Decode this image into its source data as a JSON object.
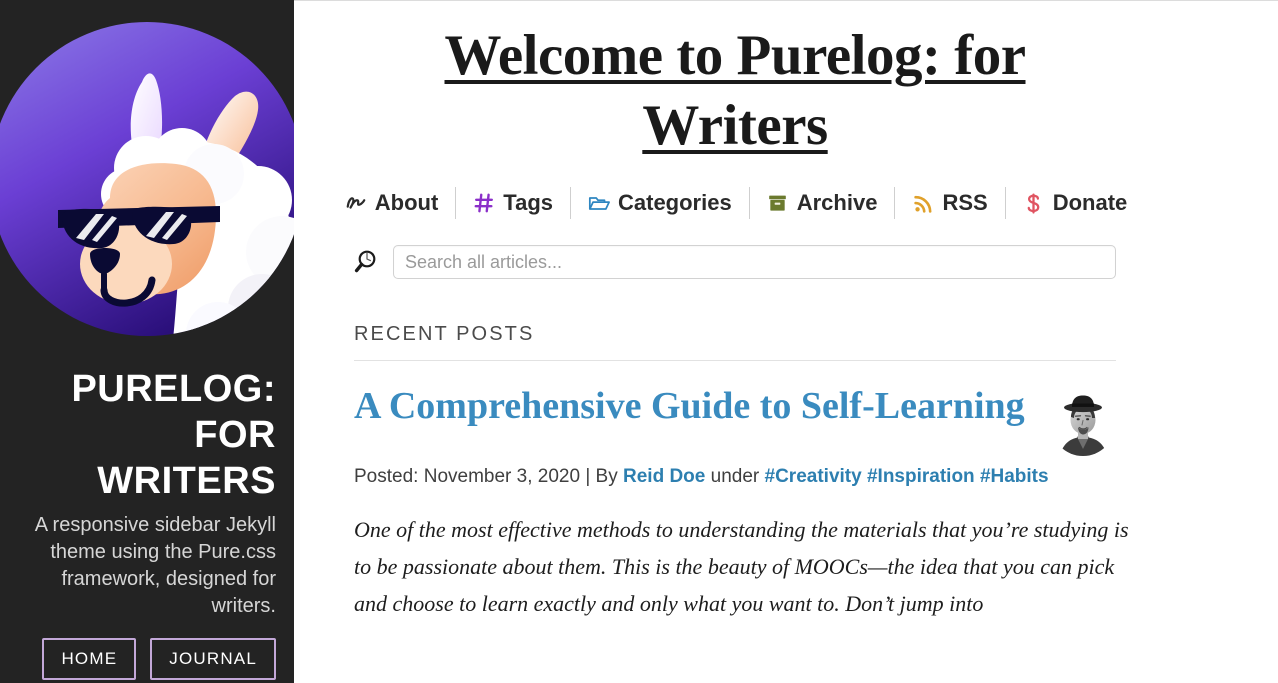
{
  "sidebar": {
    "avatar_alt": "llama-avatar",
    "title": "PURELOG: FOR WRITERS",
    "tagline": "A responsive sidebar Jekyll theme using the Pure.css framework, designed for writers.",
    "buttons": [
      {
        "label": "HOME",
        "name": "home-button"
      },
      {
        "label": "JOURNAL",
        "name": "journal-button"
      }
    ],
    "colors": {
      "background": "#232323",
      "button_border": "#c3a8d8",
      "tagline_text": "#d6d6d6"
    }
  },
  "header": {
    "title": "Welcome to Purelog: for Writers"
  },
  "nav": {
    "items": [
      {
        "label": "About",
        "icon": "signature-squiggle-icon",
        "icon_color": "#2b2b2b"
      },
      {
        "label": "Tags",
        "icon": "hash-icon",
        "icon_color": "#8b2fc9"
      },
      {
        "label": "Categories",
        "icon": "open-folder-icon",
        "icon_color": "#2e86c1"
      },
      {
        "label": "Archive",
        "icon": "file-box-icon",
        "icon_color": "#6b7a2e"
      },
      {
        "label": "RSS",
        "icon": "rss-icon",
        "icon_color": "#e0a12b"
      },
      {
        "label": "Donate",
        "icon": "dollar-sign-icon",
        "icon_color": "#e05562"
      }
    ]
  },
  "search": {
    "placeholder": "Search all articles...",
    "value": "",
    "icon": "magnifying-glass-icon"
  },
  "main": {
    "section_heading": "RECENT POSTS",
    "posts": [
      {
        "title": "A Comprehensive Guide to Self-Learning",
        "title_color": "#3a8bbf",
        "meta_prefix": "Posted: ",
        "date": "November 3, 2020",
        "meta_separator": " | By ",
        "author": "Reid Doe",
        "meta_under": " under ",
        "tags": [
          "#Creativity",
          "#Inspiration",
          "#Habits"
        ],
        "excerpt": "One of the most effective methods to understanding the materials that you’re studying is to be passionate about them. This is the beauty of MOOCs—the idea that you can pick and choose to learn exactly and only what you want to. Don’t jump into",
        "thumbnail_alt": "author-portrait"
      }
    ]
  }
}
